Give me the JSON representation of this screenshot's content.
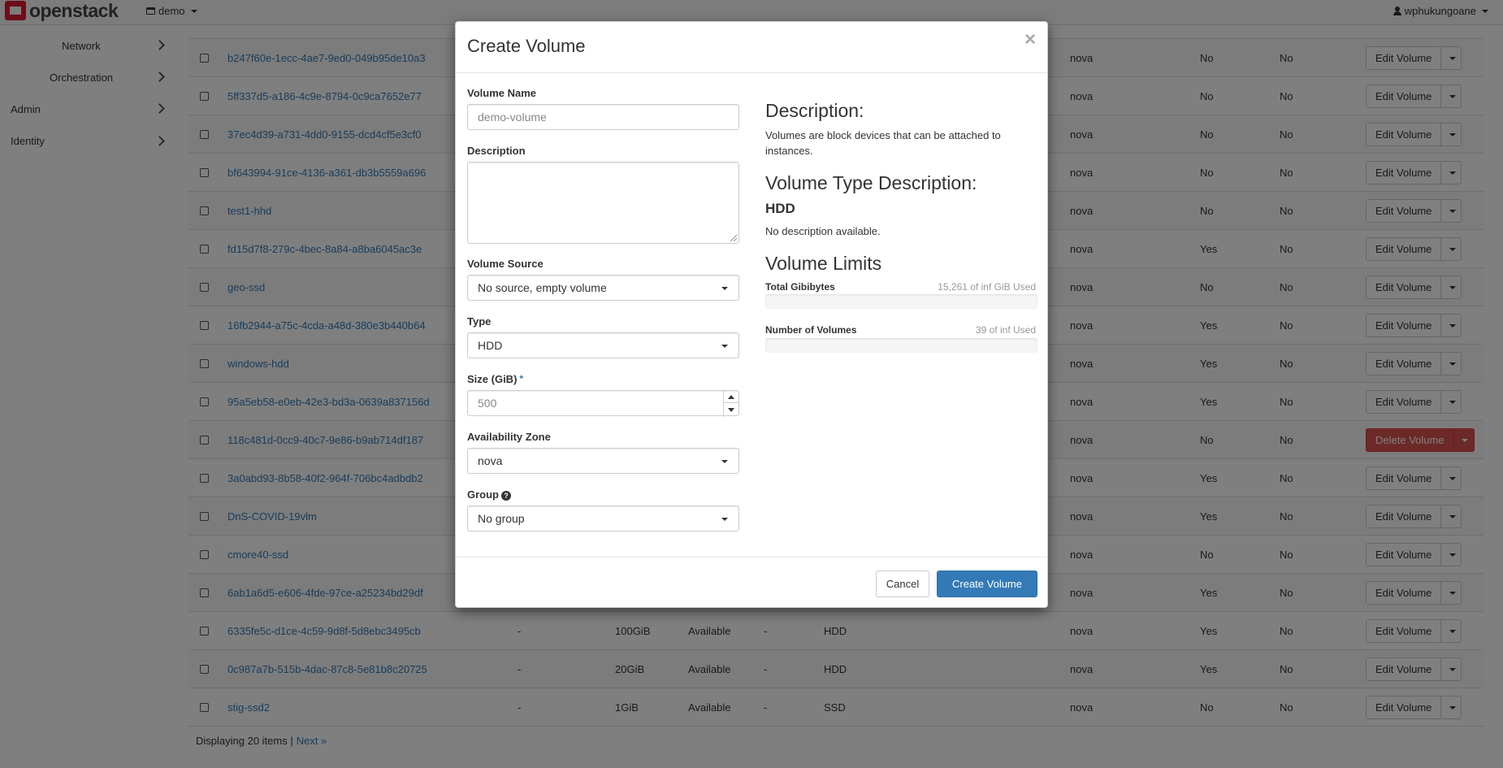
{
  "navbar": {
    "brand": "openstack",
    "project": "demo",
    "user": "wphukungoane"
  },
  "sidebar": {
    "items": [
      {
        "label": "Network"
      },
      {
        "label": "Orchestration"
      },
      {
        "label": "Admin"
      },
      {
        "label": "Identity"
      }
    ]
  },
  "table": {
    "rows": [
      {
        "name": "b247f60e-1ecc-4ae7-9ed0-049b95de10a3",
        "az": "nova",
        "bootable": "No",
        "encrypted": "No",
        "action": "Edit Volume"
      },
      {
        "name": "5ff337d5-a186-4c9e-8794-0c9ca7652e77",
        "az": "nova",
        "bootable": "No",
        "encrypted": "No",
        "action": "Edit Volume"
      },
      {
        "name": "37ec4d39-a731-4dd0-9155-dcd4cf5e3cf0",
        "az": "nova",
        "bootable": "No",
        "encrypted": "No",
        "action": "Edit Volume"
      },
      {
        "name": "bf643994-91ce-4136-a361-db3b5559a696",
        "az": "nova",
        "bootable": "No",
        "encrypted": "No",
        "action": "Edit Volume"
      },
      {
        "name": "test1-hhd",
        "az": "nova",
        "bootable": "No",
        "encrypted": "No",
        "action": "Edit Volume"
      },
      {
        "name": "fd15d7f8-279c-4bec-8a84-a8ba6045ac3e",
        "az": "nova",
        "bootable": "Yes",
        "encrypted": "No",
        "action": "Edit Volume"
      },
      {
        "name": "geo-ssd",
        "az": "nova",
        "bootable": "No",
        "encrypted": "No",
        "action": "Edit Volume"
      },
      {
        "name": "16fb2944-a75c-4cda-a48d-380e3b440b64",
        "az": "nova",
        "bootable": "Yes",
        "encrypted": "No",
        "action": "Edit Volume"
      },
      {
        "name": "windows-hdd",
        "az": "nova",
        "bootable": "Yes",
        "encrypted": "No",
        "action": "Edit Volume"
      },
      {
        "name": "95a5eb58-e0eb-42e3-bd3a-0639a837156d",
        "az": "nova",
        "bootable": "Yes",
        "encrypted": "No",
        "action": "Edit Volume"
      },
      {
        "name": "118c481d-0cc9-40c7-9e86-b9ab714df187",
        "az": "nova",
        "bootable": "No",
        "encrypted": "No",
        "action": "Delete Volume"
      },
      {
        "name": "3a0abd93-8b58-40f2-964f-706bc4adbdb2",
        "az": "nova",
        "bootable": "Yes",
        "encrypted": "No",
        "action": "Edit Volume"
      },
      {
        "name": "DnS-COVID-19vlm",
        "az": "nova",
        "bootable": "Yes",
        "encrypted": "No",
        "action": "Edit Volume"
      },
      {
        "name": "cmore40-ssd",
        "az": "nova",
        "bootable": "No",
        "encrypted": "No",
        "action": "Edit Volume"
      },
      {
        "name": "6ab1a6d5-e606-4fde-97ce-a25234bd29df",
        "az": "nova",
        "bootable": "Yes",
        "encrypted": "No",
        "action": "Edit Volume"
      },
      {
        "name": "6335fe5c-d1ce-4c59-9d8f-5d8ebc3495cb",
        "desc": "-",
        "size": "100GiB",
        "status": "Available",
        "group": "-",
        "type": "HDD",
        "az": "nova",
        "bootable": "Yes",
        "encrypted": "No",
        "action": "Edit Volume"
      },
      {
        "name": "0c987a7b-515b-4dac-87c8-5e81b8c20725",
        "desc": "-",
        "size": "20GiB",
        "status": "Available",
        "group": "-",
        "type": "HDD",
        "az": "nova",
        "bootable": "Yes",
        "encrypted": "No",
        "action": "Edit Volume"
      },
      {
        "name": "stig-ssd2",
        "desc": "-",
        "size": "1GiB",
        "status": "Available",
        "group": "-",
        "type": "SSD",
        "az": "nova",
        "bootable": "No",
        "encrypted": "No",
        "action": "Edit Volume"
      }
    ],
    "footer_text": "Displaying 20 items |",
    "next_link": "Next »"
  },
  "modal": {
    "title": "Create Volume",
    "close": "×",
    "fields": {
      "volume_name_label": "Volume Name",
      "volume_name_placeholder": "demo-volume",
      "description_label": "Description",
      "volume_source_label": "Volume Source",
      "volume_source_value": "No source, empty volume",
      "type_label": "Type",
      "type_value": "HDD",
      "size_label": "Size (GiB)",
      "size_required": "*",
      "size_value": "500",
      "az_label": "Availability Zone",
      "az_value": "nova",
      "group_label": "Group",
      "group_value": "No group"
    },
    "info": {
      "description_heading": "Description:",
      "description_text": "Volumes are block devices that can be attached to instances.",
      "type_desc_heading": "Volume Type Description:",
      "type_name": "HDD",
      "type_desc_text": "No description available.",
      "limits_heading": "Volume Limits",
      "total_gib_label": "Total Gibibytes",
      "total_gib_value": "15,261 of inf GiB Used",
      "total_gib_fraction": 0,
      "num_volumes_label": "Number of Volumes",
      "num_volumes_value": "39 of inf Used",
      "num_volumes_fraction": 0
    },
    "buttons": {
      "cancel": "Cancel",
      "submit": "Create Volume"
    }
  },
  "colors": {
    "link": "#337ab7",
    "primary": "#337ab7",
    "danger": "#d9534f",
    "brand": "#da1a32"
  }
}
